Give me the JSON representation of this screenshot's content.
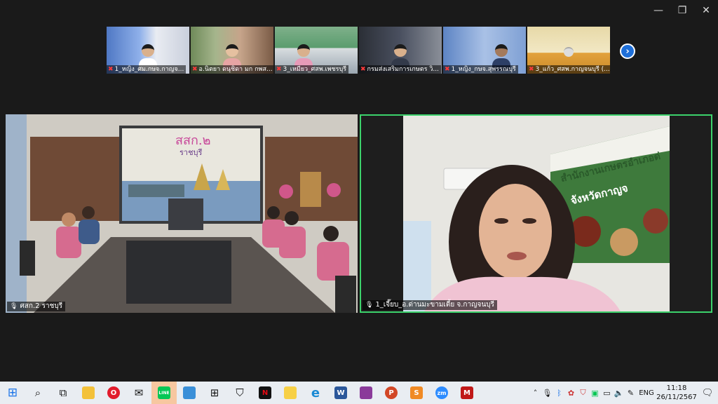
{
  "window": {
    "minimize": "—",
    "restore": "❐",
    "close": "✕"
  },
  "thumbnails": [
    {
      "name": "1_หญิง_ศม.กษจ.กาญจ..."
    },
    {
      "name": "อ.นิตยา ดนุชิดา มก กพส..."
    },
    {
      "name": "3_เหมียว_ศสพ.เพชรบุรี"
    },
    {
      "name": "กรมส่งเสริมการเกษตร วิ..."
    },
    {
      "name": "1_หญิง_กษจ.สุพรรณบุรี"
    },
    {
      "name": "3_แก้ว_ศสพ.กาญจนบุรี (..."
    }
  ],
  "next_page": "›",
  "main_tiles": {
    "left": {
      "name": "ศสก.2 ราชบุรี",
      "banner_title": "สสก.๒",
      "banner_subtitle": "ราชบุรี"
    },
    "right": {
      "name": "1_เจี๊ยบ_อ.ด่านมะขามเตี้ย จ.กาญจนบุรี",
      "wall_sign_line1": "สำนักงานเกษตรอำเภอด่",
      "wall_sign_line2": "จังหวัดกาญจ"
    }
  },
  "taskbar": {
    "apps": [
      {
        "name": "windows-start",
        "glyph": "⊞"
      },
      {
        "name": "search",
        "glyph": "⌕"
      },
      {
        "name": "task-view",
        "glyph": "⧉"
      },
      {
        "name": "file-explorer",
        "glyph": "📁"
      },
      {
        "name": "opera",
        "glyph": "O"
      },
      {
        "name": "mail",
        "glyph": "✉"
      },
      {
        "name": "line",
        "glyph": "LINE"
      },
      {
        "name": "photos",
        "glyph": "▣"
      },
      {
        "name": "app-grid",
        "glyph": "⊞"
      },
      {
        "name": "security",
        "glyph": "⛉"
      },
      {
        "name": "netflix",
        "glyph": "N"
      },
      {
        "name": "sticky-notes",
        "glyph": "▤"
      },
      {
        "name": "edge",
        "glyph": "e"
      },
      {
        "name": "word",
        "glyph": "W"
      },
      {
        "name": "winrar",
        "glyph": "▥"
      },
      {
        "name": "powerpoint",
        "glyph": "P"
      },
      {
        "name": "sublime",
        "glyph": "S"
      },
      {
        "name": "zoom",
        "glyph": "zm"
      },
      {
        "name": "mcafee",
        "glyph": "M"
      }
    ],
    "tray": {
      "language": "ENG",
      "time": "11:18",
      "date": "26/11/2567"
    }
  }
}
